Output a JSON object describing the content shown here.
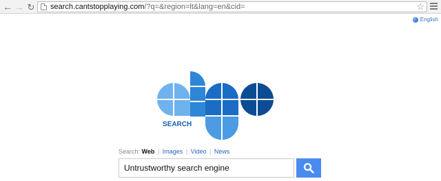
{
  "browser": {
    "url_domain": "search.cantstopplaying.com",
    "url_path": "/?q=&region=lt&lang=en&cid=",
    "nav": {
      "back_glyph": "←",
      "forward_glyph": "→",
      "reload_glyph": "↻",
      "star_glyph": "☆"
    }
  },
  "header": {
    "language_label": "English"
  },
  "logo": {
    "tagline": "SEARCH",
    "colors": {
      "light": "#6fb3ee",
      "mid": "#2e86d6",
      "dark": "#0d4c94"
    }
  },
  "search": {
    "prefix": "Search:",
    "tabs": [
      {
        "label": "Web",
        "active": true
      },
      {
        "label": "Images",
        "active": false
      },
      {
        "label": "Video",
        "active": false
      },
      {
        "label": "News",
        "active": false
      }
    ],
    "value": "Untrustworthy search engine",
    "button_color": "#4a8bf0"
  }
}
